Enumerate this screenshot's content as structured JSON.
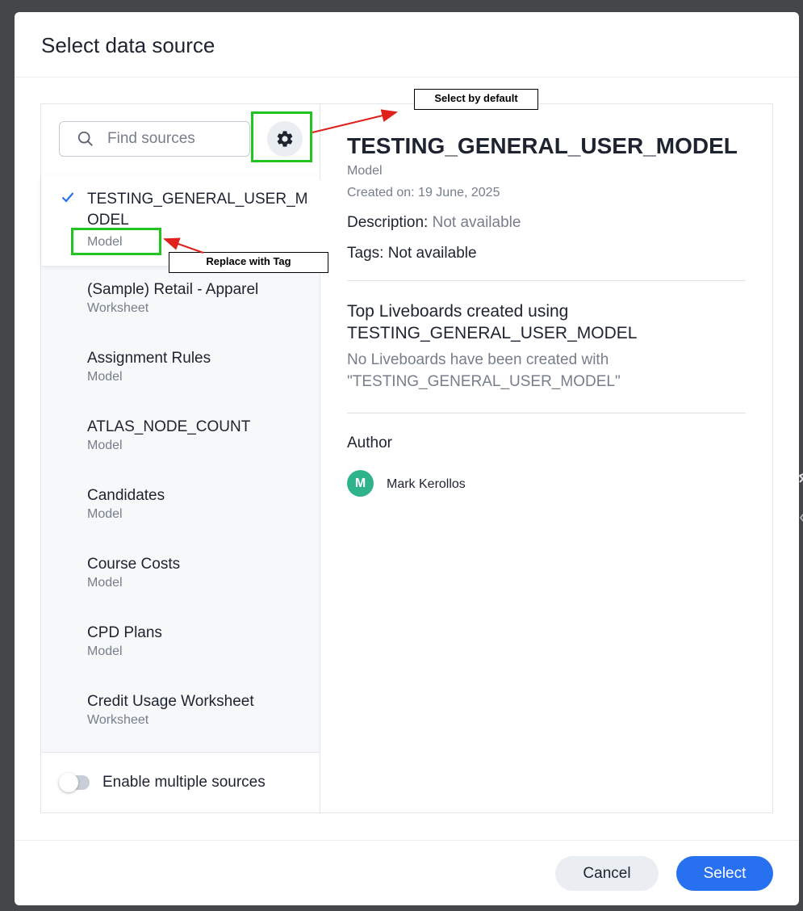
{
  "dialog": {
    "title": "Select data source"
  },
  "search": {
    "placeholder": "Find sources"
  },
  "sources": [
    {
      "name": "TESTING_GENERAL_USER_M\nODEL",
      "type": "Model",
      "selected": true
    },
    {
      "name": "(Sample) Retail - Apparel",
      "type": "Worksheet"
    },
    {
      "name": "Assignment Rules",
      "type": "Model"
    },
    {
      "name": "ATLAS_NODE_COUNT",
      "type": "Model"
    },
    {
      "name": "Candidates",
      "type": "Model"
    },
    {
      "name": "Course Costs",
      "type": "Model"
    },
    {
      "name": "CPD Plans",
      "type": "Model"
    },
    {
      "name": "Credit Usage Worksheet",
      "type": "Worksheet"
    }
  ],
  "toggle": {
    "label": "Enable multiple sources",
    "on": false
  },
  "details": {
    "title": "TESTING_GENERAL_USER_MODEL",
    "type": "Model",
    "created": "Created on: 19 June, 2025",
    "description_label": "Description:",
    "description_value": "Not available",
    "tags_label": "Tags:",
    "tags_value": "Not available",
    "top_heading": "Top Liveboards created using TESTING_GENERAL_USER_MODEL",
    "empty_text": "No Liveboards have been created with \"TESTING_GENERAL_USER_MODEL\"",
    "author_heading": "Author",
    "author_initial": "M",
    "author_name": "Mark Kerollos"
  },
  "footer": {
    "cancel_label": "Cancel",
    "select_label": "Select"
  },
  "annotations": {
    "select_by_default": "Select by default",
    "replace_with_tag": "Replace with Tag"
  },
  "icons": {
    "search": "search-icon",
    "settings": "gear-icon",
    "check": "check-icon"
  },
  "colors": {
    "accent": "#2770ef",
    "annotation_box": "#22c41f",
    "annotation_arrow": "#e0201b",
    "avatar": "#2fb38a"
  }
}
